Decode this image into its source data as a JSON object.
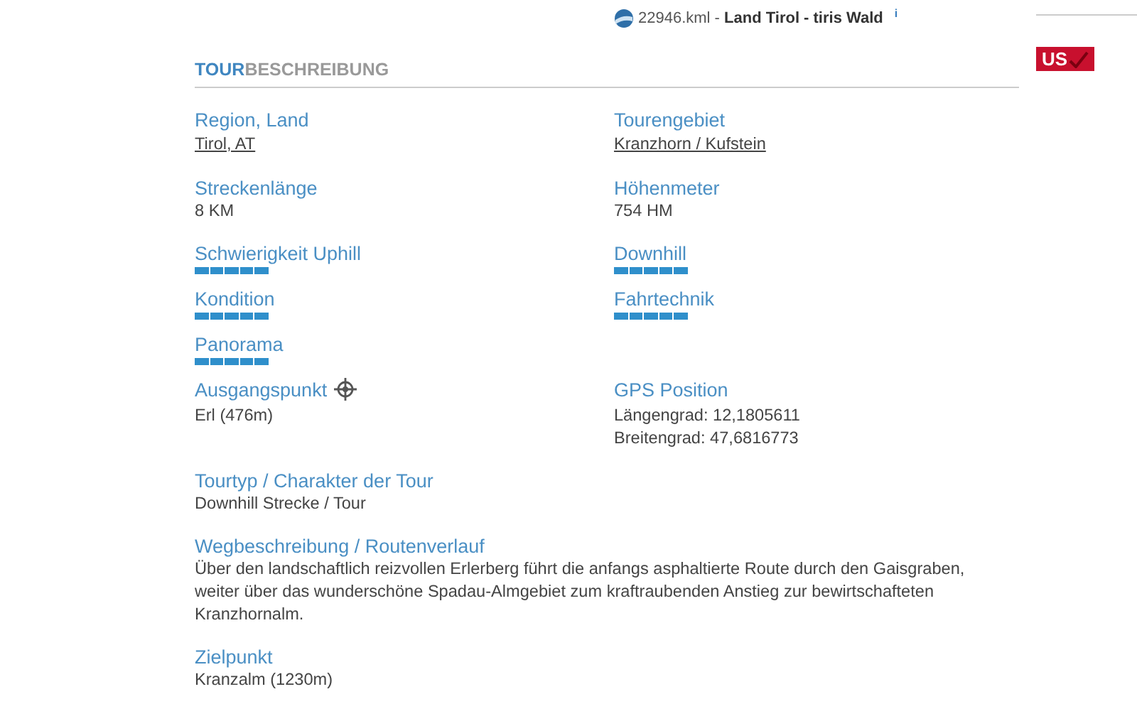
{
  "kml_link": {
    "text": "22946.kml - **Land Tirol - tiris Wald**",
    "info": "i"
  },
  "badge": {
    "text": "US",
    "checked": true
  },
  "section": {
    "title_strong": "TOUR",
    "title_rest": "BESCHREIBUNG"
  },
  "rows": [
    [
      {
        "kind": "link",
        "label": "Region, Land",
        "value": "Tirol, AT"
      },
      {
        "kind": "link",
        "label": "Tourengebiet",
        "value": "Kranzhorn / Kufstein"
      }
    ],
    [
      {
        "kind": "text",
        "label": "Streckenlänge",
        "value": "8 KM"
      },
      {
        "kind": "text",
        "label": "Höhenmeter",
        "value": "754 HM"
      }
    ],
    [
      {
        "kind": "rating",
        "label": "Schwierigkeit Uphill",
        "stars": 5
      },
      {
        "kind": "rating",
        "label": "Downhill",
        "stars": 5
      }
    ],
    [
      {
        "kind": "rating",
        "label": "Kondition",
        "stars": 5
      },
      {
        "kind": "rating",
        "label": "Fahrtechnik",
        "stars": 5
      }
    ],
    [
      {
        "kind": "rating",
        "label": "Panorama",
        "stars": 5
      }
    ],
    [
      {
        "kind": "location",
        "label": "Ausgangspunkt",
        "value": "Erl (476m)"
      },
      {
        "kind": "lines",
        "label": "GPS Position",
        "lines": [
          "Längengrad: 12,1805611",
          "Breitengrad: 47,6816773"
        ]
      }
    ],
    [
      {
        "kind": "text",
        "label": "Tourtyp / Charakter der Tour",
        "value": "Downhill Strecke / Tour"
      }
    ],
    [
      {
        "kind": "text",
        "label": "Wegbeschreibung / Routenverlauf",
        "value": "Über den landschaftlich reizvollen Erlerberg führt die anfangs asphaltierte Route durch den Gaisgraben, weiter über das wunderschöne Spadau-Almgebiet zum kraftraubenden Anstieg zur bewirtschafteten Kranzhornalm."
      }
    ],
    [
      {
        "kind": "text",
        "label": "Zielpunkt",
        "value": "Kranzalm (1230m)"
      }
    ]
  ]
}
